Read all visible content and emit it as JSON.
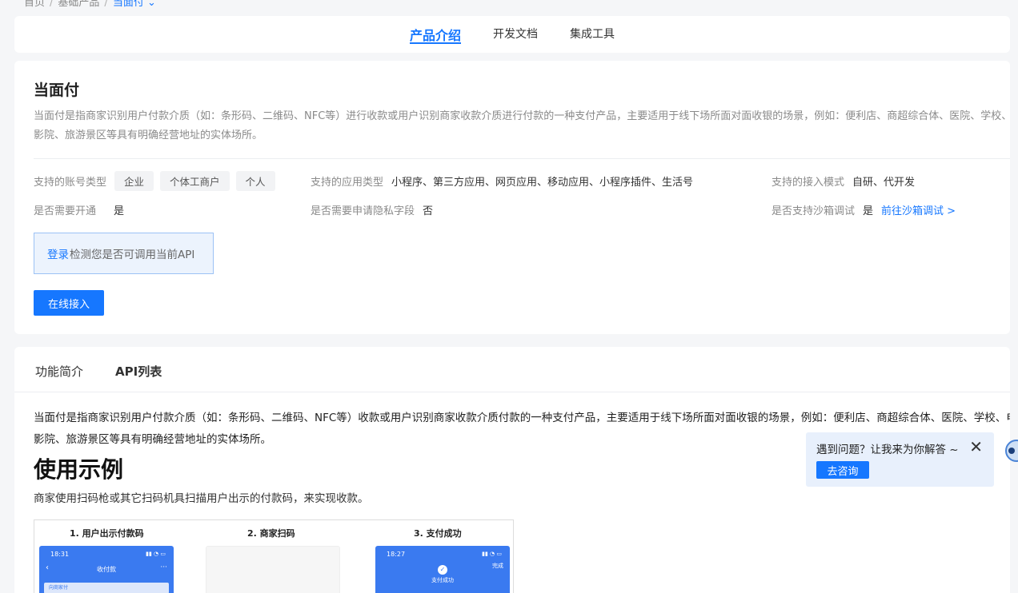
{
  "breadcrumb": {
    "items": [
      "首页",
      "基础产品",
      "当面付"
    ],
    "dropdown_icon": "chevron-down-icon"
  },
  "top_tabs": [
    {
      "label": "产品介绍",
      "active": true
    },
    {
      "label": "开发文档",
      "active": false
    },
    {
      "label": "集成工具",
      "active": false
    }
  ],
  "product": {
    "title": "当面付",
    "description": "当面付是指商家识别用户付款介质（如：条形码、二维码、NFC等）进行收款或用户识别商家收款介质进行付款的一种支付产品，主要适用于线下场所面对面收银的场景，例如：便利店、商超综合体、医院、学校、电影院、旅游景区等具有明确经营地址的实体场所。",
    "account_types_label": "支持的账号类型",
    "account_types": [
      "企业",
      "个体工商户",
      "个人"
    ],
    "app_types_label": "支持的应用类型",
    "app_types_value": "小程序、第三方应用、网页应用、移动应用、小程序插件、生活号",
    "access_mode_label": "支持的接入模式",
    "access_mode_value": "自研、代开发",
    "need_open_label": "是否需要开通",
    "need_open_value": "是",
    "privacy_label": "是否需要申请隐私字段",
    "privacy_value": "否",
    "sandbox_label": "是否支持沙箱调试",
    "sandbox_value": "是",
    "sandbox_link": "前往沙箱调试 >",
    "login_link": "登录",
    "login_text": "检测您是否可调用当前API",
    "online_button": "在线接入"
  },
  "content_tabs": [
    "功能简介",
    "API列表"
  ],
  "intro_text": "当面付是指商家识别用户付款介质（如：条形码、二维码、NFC等）收款或用户识别商家收款介质付款的一种支付产品，主要适用于线下场所面对面收银的场景，例如：便利店、商超综合体、医院、学校、电影院、旅游景区等具有明确经营地址的实体场所。",
  "example": {
    "title": "使用示例",
    "description": "商家使用扫码枪或其它扫码机具扫描用户出示的付款码，来实现收款。",
    "steps": [
      "1. 用户出示付款码",
      "2. 商家扫码",
      "3. 支付成功"
    ],
    "phone1": {
      "time": "18:31",
      "title": "收付款",
      "bar": "向商家付"
    },
    "phone3": {
      "time": "18:27",
      "done": "完成",
      "status": "支付成功"
    }
  },
  "helper": {
    "question": "遇到问题？让我来为你解答 ~",
    "button": "去咨询"
  }
}
